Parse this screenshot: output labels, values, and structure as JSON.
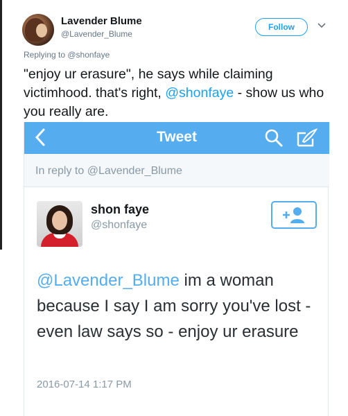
{
  "tweet": {
    "author_name": "Lavender Blume",
    "author_handle": "@Lavender_Blume",
    "follow_label": "Follow",
    "replying_prefix": "Replying to ",
    "replying_to": "@shonfaye",
    "text_part1": "\"enjoy ur erasure\", he says while claiming victimhood. that's right, ",
    "text_mention": "@shonfaye",
    "text_part2": " - show us who you really are."
  },
  "screenshot": {
    "nav_title": "Tweet",
    "reply_bar": "In reply to @Lavender_Blume",
    "author_name": "shon faye",
    "author_handle": "@shonfaye",
    "text_mention": "@Lavender_Blume",
    "text_body": " im a woman because I say I am sorry you've lost - even law says so - enjoy ur erasure",
    "timestamp": "2016-07-14 1:17 PM",
    "nav_color": "#55acee",
    "link_color": "#55acee"
  },
  "colors": {
    "twitter_blue": "#1da1f2",
    "secondary_text": "#657786"
  },
  "icons": {
    "back": "chevron-left-icon",
    "search": "search-icon",
    "compose": "compose-icon",
    "follow": "add-user-icon",
    "menu": "chevron-down-icon"
  }
}
